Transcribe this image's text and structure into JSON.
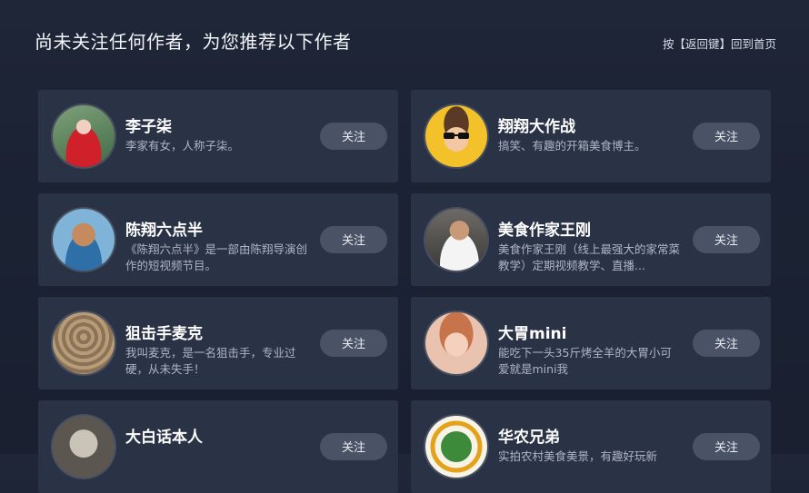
{
  "header": {
    "title": "尚未关注任何作者，为您推荐以下作者",
    "hint": "按【返回键】回到首页"
  },
  "authors": [
    {
      "name": "李子柒",
      "desc": "李家有女，人称子柒。",
      "follow_label": "关注"
    },
    {
      "name": "翔翔大作战",
      "desc": "搞笑、有趣的开箱美食博主。",
      "follow_label": "关注"
    },
    {
      "name": "陈翔六点半",
      "desc": "《陈翔六点半》是一部由陈翔导演创作的短视频节目。",
      "follow_label": "关注"
    },
    {
      "name": "美食作家王刚",
      "desc": "美食作家王刚（线上最强大的家常菜教学）定期视频教学、直播...",
      "follow_label": "关注"
    },
    {
      "name": "狙击手麦克",
      "desc": "我叫麦克，是一名狙击手，专业过硬，从未失手！",
      "follow_label": "关注"
    },
    {
      "name": "大胃mini",
      "desc": "能吃下一头35斤烤全羊的大胃小可爱就是mini我",
      "follow_label": "关注"
    },
    {
      "name": "大白话本人",
      "desc": "",
      "follow_label": "关注"
    },
    {
      "name": "华农兄弟",
      "desc": "实拍农村美食美景，有趣好玩新",
      "follow_label": "关注"
    }
  ]
}
